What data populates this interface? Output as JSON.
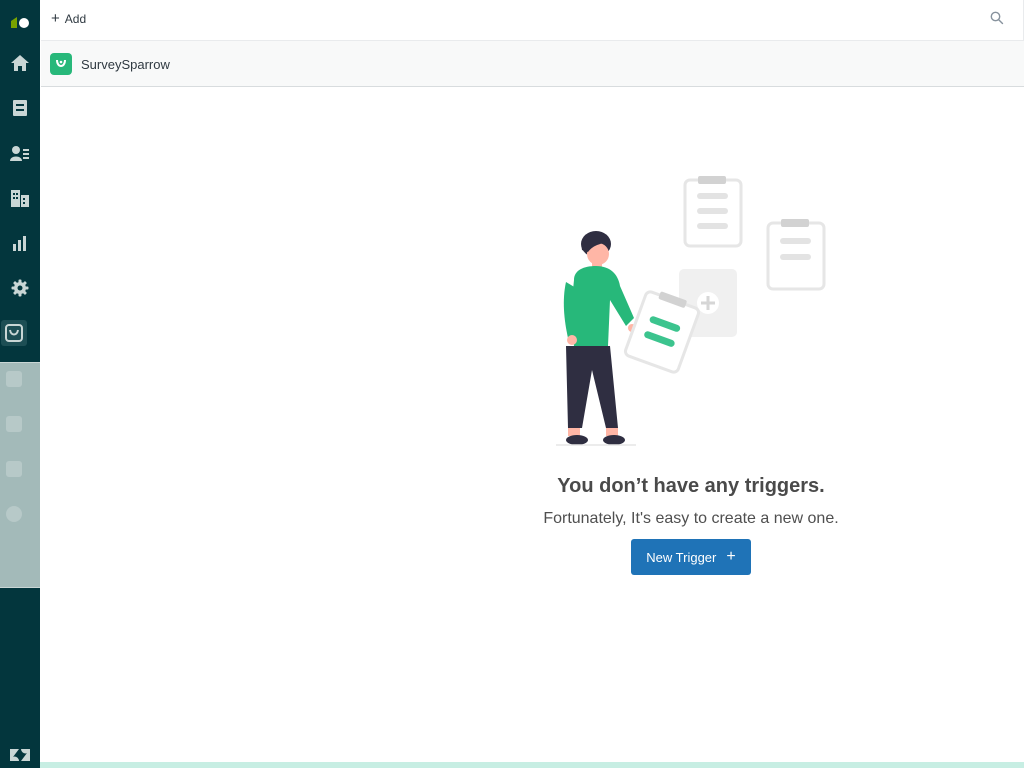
{
  "topbar": {
    "add_label": "Add"
  },
  "app": {
    "name": "SurveySparrow"
  },
  "empty_state": {
    "title": "You don’t have any triggers.",
    "subtitle": "Fortunately, It's easy to create a new one.",
    "button_label": "New Trigger"
  },
  "colors": {
    "rail": "#03363d",
    "accent_green": "#27b87a",
    "primary_blue": "#1f73b7"
  },
  "icons": [
    "zendesk-logo-icon",
    "home-icon",
    "views-icon",
    "customers-icon",
    "organizations-icon",
    "reporting-icon",
    "admin-icon",
    "surveysparrow-icon",
    "zendesk-icon",
    "search-icon",
    "plus-icon"
  ]
}
